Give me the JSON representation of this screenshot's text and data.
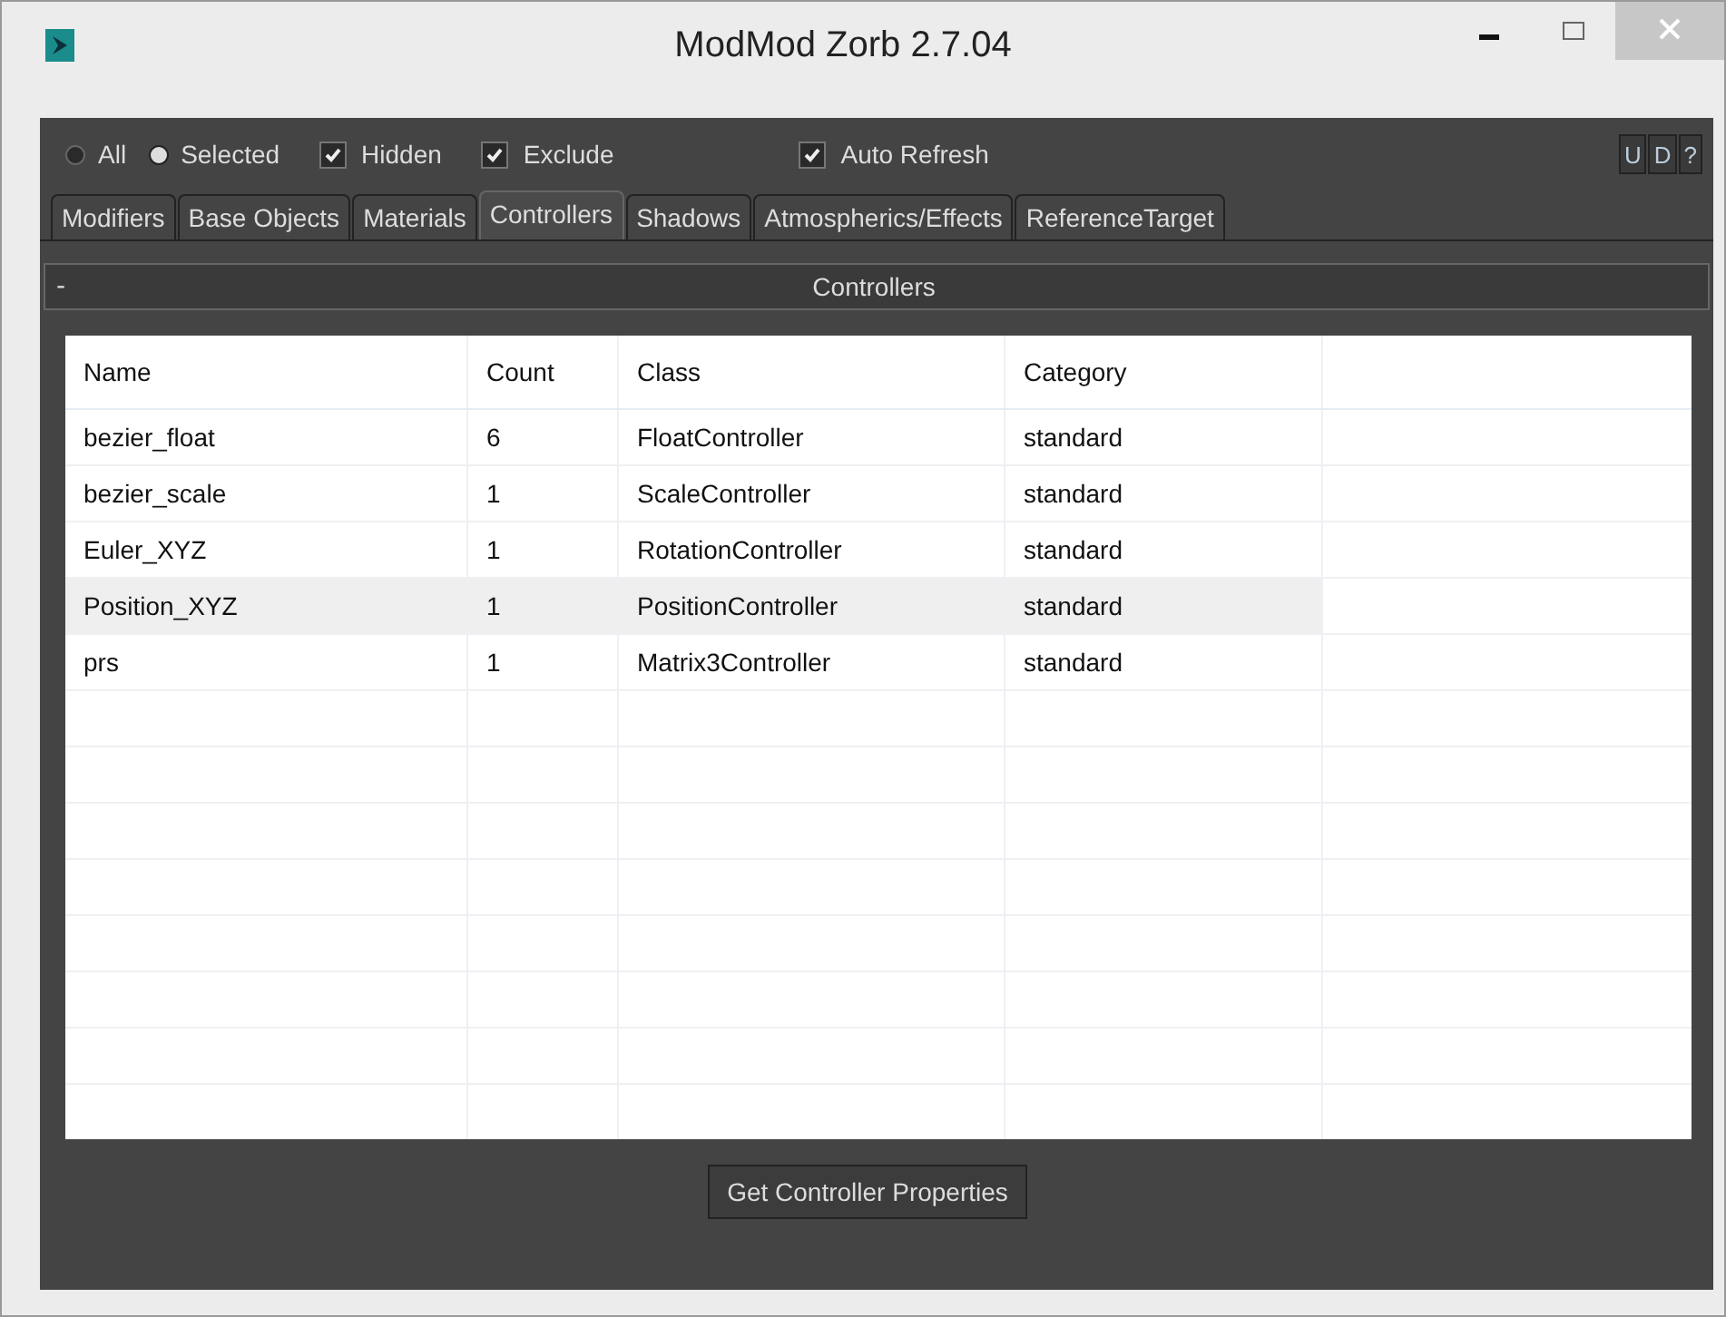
{
  "window": {
    "title": "ModMod Zorb 2.7.04"
  },
  "options": [
    {
      "kind": "radio",
      "label": "All",
      "checked": false
    },
    {
      "kind": "radio",
      "label": "Selected",
      "checked": true
    },
    {
      "kind": "checkbox",
      "label": "Hidden",
      "checked": true
    },
    {
      "kind": "checkbox",
      "label": "Exclude",
      "checked": true
    },
    {
      "kind": "checkbox",
      "label": "Auto Refresh",
      "checked": true
    }
  ],
  "small_buttons": [
    "U",
    "D",
    "?"
  ],
  "tabs": [
    {
      "label": "Modifiers",
      "selected": false
    },
    {
      "label": "Base Objects",
      "selected": false
    },
    {
      "label": "Materials",
      "selected": false
    },
    {
      "label": "Controllers",
      "selected": true
    },
    {
      "label": "Shadows",
      "selected": false
    },
    {
      "label": "Atmospherics/Effects",
      "selected": false
    },
    {
      "label": "ReferenceTarget",
      "selected": false
    }
  ],
  "rollout": {
    "toggle": "-",
    "title": "Controllers"
  },
  "table": {
    "columns": [
      "Name",
      "Count",
      "Class",
      "Category"
    ],
    "rows": [
      {
        "cells": [
          "bezier_float",
          "6",
          "FloatController",
          "standard"
        ],
        "selected": false
      },
      {
        "cells": [
          "bezier_scale",
          "1",
          "ScaleController",
          "standard"
        ],
        "selected": false
      },
      {
        "cells": [
          "Euler_XYZ",
          "1",
          "RotationController",
          "standard"
        ],
        "selected": false
      },
      {
        "cells": [
          "Position_XYZ",
          "1",
          "PositionController",
          "standard"
        ],
        "selected": true
      },
      {
        "cells": [
          "prs",
          "1",
          "Matrix3Controller",
          "standard"
        ],
        "selected": false
      }
    ]
  },
  "action_button": "Get Controller Properties"
}
